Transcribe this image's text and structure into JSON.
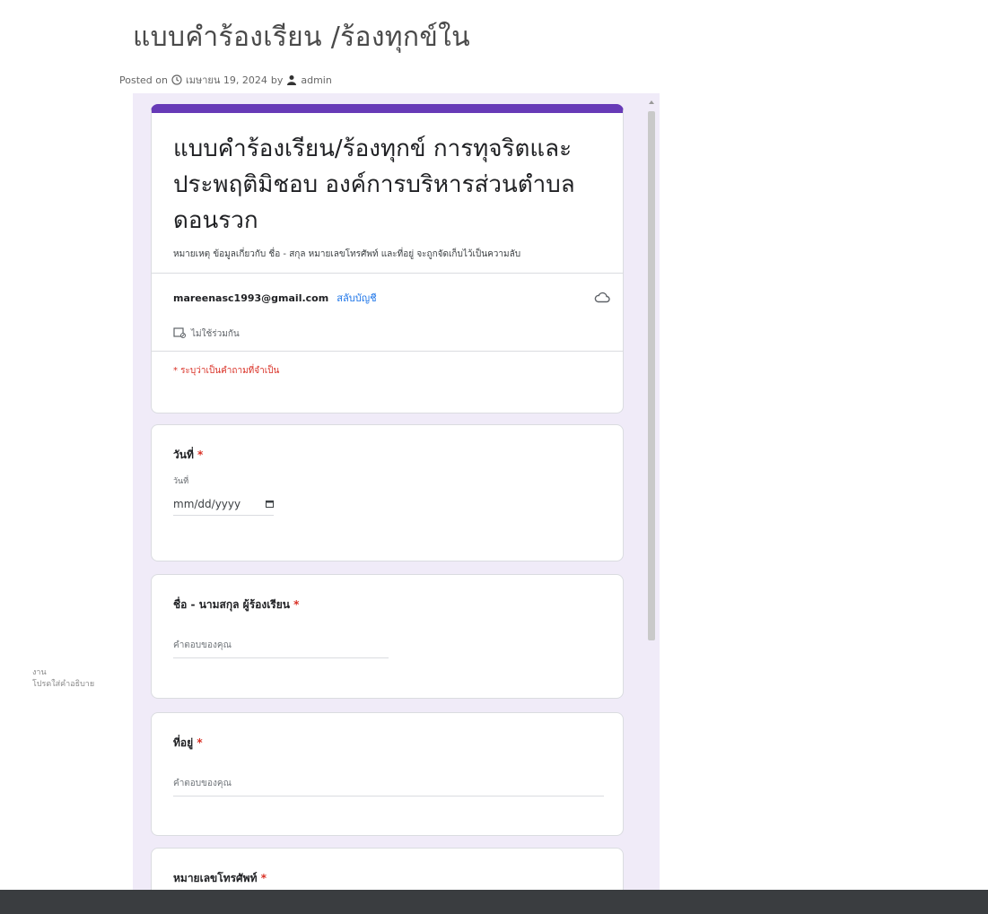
{
  "page": {
    "title": "แบบคำร้องเรียน /ร้องทุกข์ใน",
    "posted_prefix": "Posted on",
    "posted_date": "เมษายน 19, 2024",
    "posted_by": "by",
    "author": "admin",
    "side_text_1": "งาน",
    "side_text_2": "โปรดใส่คำอธิบาย"
  },
  "form": {
    "accent_color": "#673ab7",
    "title": "แบบคำร้องเรียน/ร้องทุกข์ การทุจริตและประพฤติมิชอบ องค์การบริหารส่วนตำบลดอนรวก",
    "description": "หมายเหตุ ข้อมูลเกี่ยวกับ ชื่อ - สกุล หมายเลขโทรศัพท์ และที่อยู่ จะถูกจัดเก็บไว้เป็นความลับ",
    "account_email": "mareenasc1993@gmail.com",
    "switch_account": "สลับบัญชี",
    "not_shared": "ไม่ใช้ร่วมกัน",
    "required_note": "* ระบุว่าเป็นคำถามที่จำเป็น"
  },
  "questions": [
    {
      "label": "วันที่",
      "required": "*",
      "sub": "วันที่",
      "placeholder": "mm/dd/yyyy"
    },
    {
      "label": "ชื่อ - นามสกุล ผู้ร้องเรียน",
      "required": "*",
      "placeholder": "คำตอบของคุณ"
    },
    {
      "label": "ที่อยู่",
      "required": "*",
      "placeholder": "คำตอบของคุณ"
    },
    {
      "label": "หมายเลขโทรศัพท์",
      "required": "*"
    }
  ]
}
